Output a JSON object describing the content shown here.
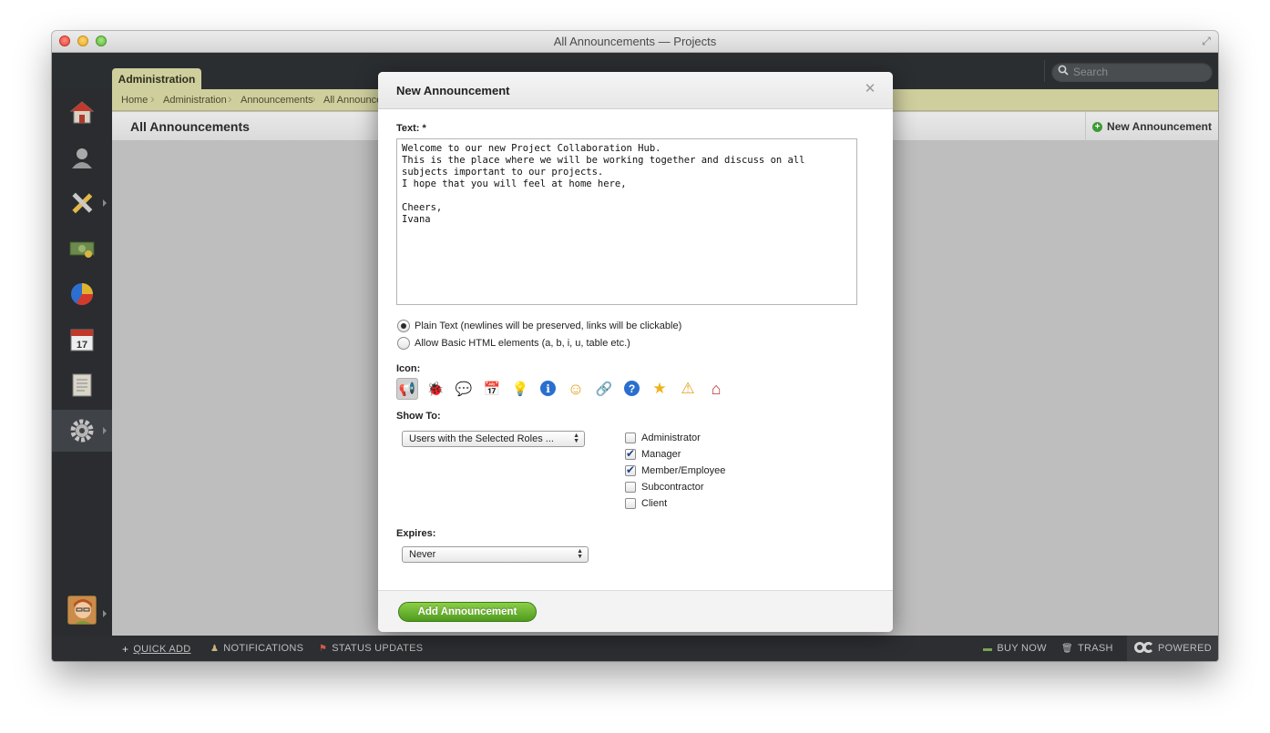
{
  "window": {
    "title": "All Announcements — Projects"
  },
  "topbar": {
    "tab": "Administration",
    "search_placeholder": "Search"
  },
  "sidebar": {
    "items": [
      {
        "name": "home",
        "icon": "home-icon"
      },
      {
        "name": "people",
        "icon": "user-icon"
      },
      {
        "name": "projects",
        "icon": "pencil-ruler-icon"
      },
      {
        "name": "invoicing",
        "icon": "money-icon"
      },
      {
        "name": "reports",
        "icon": "pie-chart-icon"
      },
      {
        "name": "calendar",
        "icon": "calendar-icon",
        "label": "17"
      },
      {
        "name": "documents",
        "icon": "document-icon"
      },
      {
        "name": "administration",
        "icon": "gear-icon",
        "active": true
      }
    ]
  },
  "breadcrumb": [
    "Home",
    "Administration",
    "Announcements",
    "All Announcements"
  ],
  "page": {
    "title": "All Announcements",
    "new_button": "New Announcement"
  },
  "modal": {
    "title": "New Announcement",
    "text_label": "Text: *",
    "text_value": "Welcome to our new Project Collaboration Hub.\nThis is the place where we will be working together and discuss on all subjects important to our projects.\nI hope that you will feel at home here,\n\nCheers,\nIvana",
    "format_options": [
      {
        "label": "Plain Text (newlines will be preserved, links will be clickable)",
        "selected": true
      },
      {
        "label": "Allow Basic HTML elements (a, b, i, u, table etc.)",
        "selected": false
      }
    ],
    "icon_label": "Icon:",
    "icons": [
      "megaphone-icon",
      "bug-icon",
      "chat-bubble-icon",
      "calendar-icon",
      "lightbulb-icon",
      "info-icon",
      "smiley-icon",
      "link-icon",
      "help-icon",
      "star-icon",
      "warning-icon",
      "home-icon"
    ],
    "icon_glyphs": [
      "📢",
      "🐞",
      "💬",
      "📅",
      "💡",
      "ℹ",
      "☺",
      "🔗",
      "?",
      "★",
      "⚠",
      "⌂"
    ],
    "show_to_label": "Show To:",
    "show_to_value": "Users with the Selected Roles ...",
    "roles": [
      {
        "label": "Administrator",
        "checked": false
      },
      {
        "label": "Manager",
        "checked": true
      },
      {
        "label": "Member/Employee",
        "checked": true
      },
      {
        "label": "Subcontractor",
        "checked": false
      },
      {
        "label": "Client",
        "checked": false
      }
    ],
    "expires_label": "Expires:",
    "expires_value": "Never",
    "submit_label": "Add Announcement"
  },
  "bottombar": {
    "quick_add": "QUICK ADD",
    "notifications": "NOTIFICATIONS",
    "status_updates": "STATUS UPDATES",
    "buy_now": "BUY NOW",
    "trash": "TRASH",
    "powered": "POWERED"
  }
}
